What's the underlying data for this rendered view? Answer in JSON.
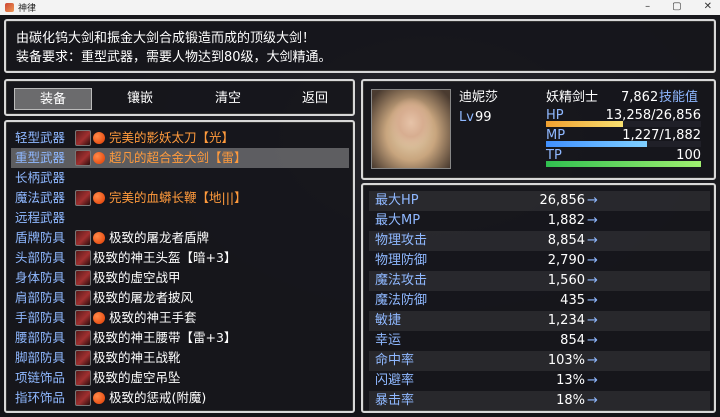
{
  "window": {
    "title": "神律"
  },
  "help": {
    "line1": "由碳化钨大剑和振金大剑合成锻造而成的顶级大剑！",
    "line2": "装备要求：重型武器，需要人物达到80级，大剑精通。"
  },
  "commands": [
    {
      "label": "装备",
      "selected": true
    },
    {
      "label": "镶嵌",
      "selected": false
    },
    {
      "label": "清空",
      "selected": false
    },
    {
      "label": "返回",
      "selected": false
    }
  ],
  "actor": {
    "name": "迪妮莎",
    "class": "妖精剑士",
    "level_label": "Lv",
    "level": "99",
    "skill_points": "7,862",
    "skill_label": "技能值",
    "hp_label": "HP",
    "hp_text": "13,258/26,856",
    "hp_ratio": 0.494,
    "mp_label": "MP",
    "mp_text": "1,227/1,882",
    "mp_ratio": 0.652,
    "tp_label": "TP",
    "tp_text": "100",
    "tp_ratio": 1.0,
    "colors": {
      "hp": "#f0a030",
      "mp": "#4090ff",
      "tp": "#30c050"
    }
  },
  "slots": [
    {
      "type": "轻型武器",
      "name": "完美的影妖太刀【光】",
      "icon": "katana-icon",
      "dot": true,
      "color": "orange",
      "selected": false
    },
    {
      "type": "重型武器",
      "name": "超凡的超合金大剑【雷】",
      "icon": "greatsword-icon",
      "dot": true,
      "color": "orange",
      "selected": true
    },
    {
      "type": "长柄武器",
      "name": "",
      "icon": "",
      "dot": false,
      "color": "",
      "selected": false
    },
    {
      "type": "魔法武器",
      "name": "完美的血蟒长鞭【地|||】",
      "icon": "whip-icon",
      "dot": true,
      "color": "orange",
      "selected": false
    },
    {
      "type": "远程武器",
      "name": "",
      "icon": "",
      "dot": false,
      "color": "",
      "selected": false
    },
    {
      "type": "盾牌防具",
      "name": "极致的屠龙者盾牌",
      "icon": "shield-icon",
      "dot": true,
      "color": "white",
      "selected": false
    },
    {
      "type": "头部防具",
      "name": "极致的神王头盔【暗+3】",
      "icon": "helmet-icon",
      "dot": false,
      "color": "white",
      "selected": false
    },
    {
      "type": "身体防具",
      "name": "极致的虚空战甲",
      "icon": "armor-icon",
      "dot": false,
      "color": "white",
      "selected": false
    },
    {
      "type": "肩部防具",
      "name": "极致的屠龙者披风",
      "icon": "cape-icon",
      "dot": false,
      "color": "white",
      "selected": false
    },
    {
      "type": "手部防具",
      "name": "极致的神王手套",
      "icon": "gloves-icon",
      "dot": true,
      "color": "white",
      "selected": false
    },
    {
      "type": "腰部防具",
      "name": "极致的神王腰带【雷+3】",
      "icon": "belt-icon",
      "dot": false,
      "color": "white",
      "selected": false
    },
    {
      "type": "脚部防具",
      "name": "极致的神王战靴",
      "icon": "boots-icon",
      "dot": false,
      "color": "white",
      "selected": false
    },
    {
      "type": "项链饰品",
      "name": "极致的虚空吊坠",
      "icon": "pendant-icon",
      "dot": false,
      "color": "white",
      "selected": false
    },
    {
      "type": "指环饰品",
      "name": "极致的惩戒(附魔)",
      "icon": "ring-icon",
      "dot": true,
      "color": "white",
      "selected": false
    }
  ],
  "params": [
    {
      "name": "最大HP",
      "value": "26,856",
      "arrow": "→"
    },
    {
      "name": "最大MP",
      "value": "1,882",
      "arrow": "→"
    },
    {
      "name": "物理攻击",
      "value": "8,854",
      "arrow": "→"
    },
    {
      "name": "物理防御",
      "value": "2,790",
      "arrow": "→"
    },
    {
      "name": "魔法攻击",
      "value": "1,560",
      "arrow": "→"
    },
    {
      "name": "魔法防御",
      "value": "435",
      "arrow": "→"
    },
    {
      "name": "敏捷",
      "value": "1,234",
      "arrow": "→"
    },
    {
      "name": "幸运",
      "value": "854",
      "arrow": "→"
    },
    {
      "name": "命中率",
      "value": "103%",
      "arrow": "→"
    },
    {
      "name": "闪避率",
      "value": "13%",
      "arrow": "→"
    },
    {
      "name": "暴击率",
      "value": "18%",
      "arrow": "→"
    }
  ]
}
